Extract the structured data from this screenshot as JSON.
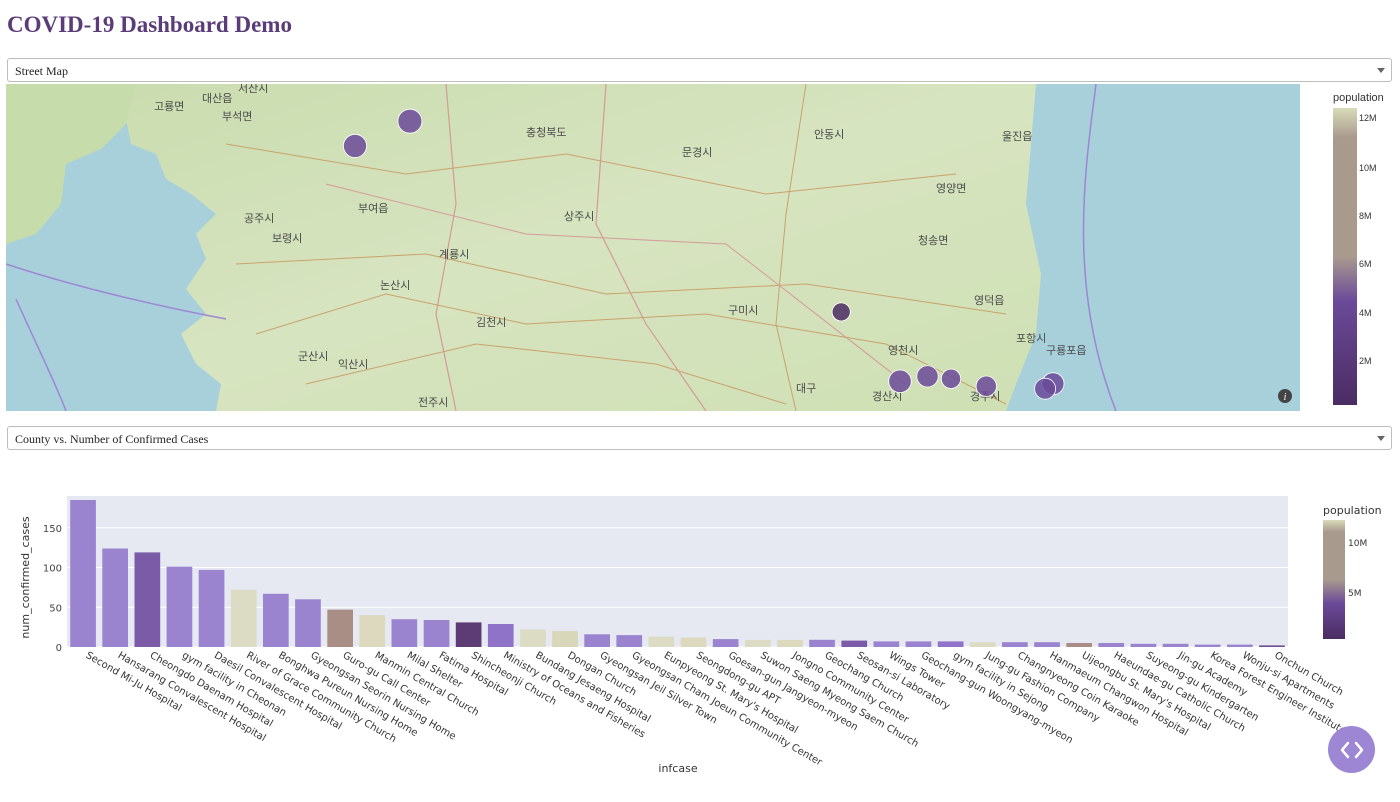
{
  "page": {
    "title": "COVID-19 Dashboard Demo"
  },
  "map_select": {
    "value": "Street Map"
  },
  "chart_select": {
    "value": "County vs. Number of Confirmed Cases"
  },
  "map": {
    "colorbar_title": "population",
    "colorbar_ticks": [
      "12M",
      "10M",
      "8M",
      "6M",
      "4M",
      "2M"
    ],
    "info_icon": "info-icon",
    "labels": [
      {
        "text": "서산시"
      },
      {
        "text": "고룡면"
      },
      {
        "text": "대산읍"
      },
      {
        "text": "부석면"
      },
      {
        "text": "공주시"
      },
      {
        "text": "부여읍"
      },
      {
        "text": "보령시"
      },
      {
        "text": "계룡시"
      },
      {
        "text": "논산시"
      },
      {
        "text": "군산시"
      },
      {
        "text": "익산시"
      },
      {
        "text": "전주시"
      },
      {
        "text": "김천시"
      },
      {
        "text": "구미시"
      },
      {
        "text": "상주시"
      },
      {
        "text": "안동시"
      },
      {
        "text": "문경시"
      },
      {
        "text": "영천시"
      },
      {
        "text": "포항시"
      },
      {
        "text": "경주시"
      },
      {
        "text": "경산시"
      },
      {
        "text": "대구"
      },
      {
        "text": "청송면"
      },
      {
        "text": "영덕읍"
      },
      {
        "text": "울진읍"
      },
      {
        "text": "영양면"
      },
      {
        "text": "충청북도"
      },
      {
        "text": "구룡포읍"
      }
    ],
    "points": [
      {
        "lon": 127.14,
        "lat": 36.8,
        "pop": 5400000
      },
      {
        "lon": 128.38,
        "lat": 36.13,
        "pop": 3800000
      },
      {
        "lon": 128.6,
        "lat": 35.87,
        "pop": 4800000
      },
      {
        "lon": 128.53,
        "lat": 35.85,
        "pop": 5200000
      },
      {
        "lon": 128.66,
        "lat": 35.86,
        "pop": 4200000
      },
      {
        "lon": 128.75,
        "lat": 35.83,
        "pop": 4500000
      },
      {
        "lon": 128.92,
        "lat": 35.84,
        "pop": 5000000
      },
      {
        "lon": 127.28,
        "lat": 36.9,
        "pop": 5600000
      },
      {
        "lon": 128.9,
        "lat": 35.82,
        "pop": 4700000
      }
    ]
  },
  "chart_data": {
    "type": "bar",
    "title": "",
    "xlabel": "infcase",
    "ylabel": "num_confirmed_cases",
    "ylim": [
      0,
      190
    ],
    "yticks": [
      0,
      50,
      100,
      150
    ],
    "color_label": "population",
    "colorbar_ticks": [
      "10M",
      "5M"
    ],
    "categories": [
      "Second Mi-Ju Hospital",
      "Hansarang Convalescent Hospital",
      "Cheongdo Daenam Hospital",
      "gym facility in Cheonan",
      "Daesil Convalescent Hospital",
      "River of Grace Community Church",
      "Bonghwa Pureun Nursing Home",
      "Gyeongsan Seorin Nursing Home",
      "Guro-gu Call Center",
      "Manmin Central Church",
      "Milal Shelter",
      "Fatima Hospital",
      "Shincheonji Church",
      "Ministry of Oceans and Fisheries",
      "Bundang Jesaeng Hospital",
      "Dongan Church",
      "Gyeongsan Jeil Silver Town",
      "Gyeongsan Cham Joeun Community Center",
      "Eunpyeong St. Mary's Hospital",
      "Seongdong-gu APT",
      "Goesan-gun Jangyeon-myeon",
      "Suwon Saeng Myeong Saem Church",
      "Jongno Community Center",
      "Geochang Church",
      "Seosan-si Laboratory",
      "Wings Tower",
      "Geochang-gun Woongyang-myeon",
      "gym facility in Sejong",
      "Jung-gu Fashion Company",
      "Changnyeong Coin Karaoke",
      "Hanmaeum Changwon Hospital",
      "Uijeongbu St. Mary's Hospital",
      "Haeundae-gu Catholic Church",
      "Suyeong-gu Kindergarten",
      "Jin-gu Academy",
      "Korea Forest Engineer Institute",
      "Wonju-si Apartments",
      "Onchun Church"
    ],
    "values": [
      185,
      124,
      119,
      101,
      97,
      72,
      67,
      60,
      47,
      40,
      35,
      34,
      31,
      29,
      22,
      20,
      16,
      15,
      13,
      12,
      10,
      9,
      9,
      9,
      8,
      7,
      7,
      7,
      6,
      6,
      6,
      5,
      5,
      4,
      4,
      3,
      3,
      2
    ],
    "colors": [
      "#9b84cf",
      "#9b84cf",
      "#7b5aa8",
      "#9b84cf",
      "#9b84cf",
      "#dcdcc4",
      "#9b84cf",
      "#9b84cf",
      "#a98e86",
      "#dcd9bf",
      "#9b84cf",
      "#9b84cf",
      "#5d3b75",
      "#8f73c8",
      "#dcdcc4",
      "#d8d7b9",
      "#9b84cf",
      "#9b84cf",
      "#dcdcc4",
      "#dcd9bf",
      "#9b84cf",
      "#dcdcc4",
      "#dcd9bf",
      "#9b84cf",
      "#7b5aa8",
      "#9b84cf",
      "#9b84cf",
      "#8f73c8",
      "#dcdcc4",
      "#9b84cf",
      "#9b84cf",
      "#a98e86",
      "#9b84cf",
      "#9b84cf",
      "#9b84cf",
      "#9b84cf",
      "#9b84cf",
      "#6e4f91"
    ]
  },
  "nav_fab": {
    "icon": "code-brackets-icon"
  }
}
